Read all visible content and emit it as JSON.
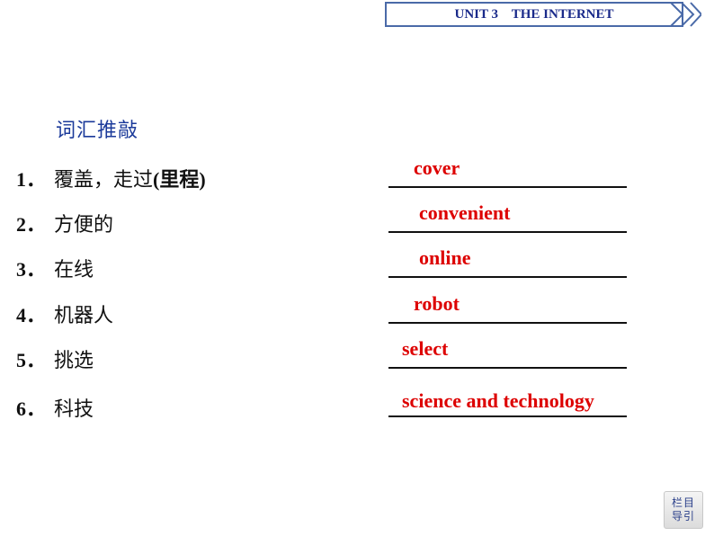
{
  "header": {
    "title": "UNIT 3    THE INTERNET"
  },
  "section": {
    "heading": "词汇推敲"
  },
  "items": [
    {
      "number": "1．",
      "prompt_cn": "覆盖，走过",
      "prompt_paren": "(里程)",
      "answer": "cover"
    },
    {
      "number": "2．",
      "prompt_cn": "方便的",
      "prompt_paren": "",
      "answer": "convenient"
    },
    {
      "number": "3．",
      "prompt_cn": "在线",
      "prompt_paren": "",
      "answer": "online"
    },
    {
      "number": "4．",
      "prompt_cn": "机器人",
      "prompt_paren": "",
      "answer": "robot"
    },
    {
      "number": "5．",
      "prompt_cn": "挑选",
      "prompt_paren": "",
      "answer": "select"
    },
    {
      "number": "6．",
      "prompt_cn": "科技",
      "prompt_paren": "",
      "answer": "science and technology"
    }
  ],
  "nav_button": {
    "line1": "栏目",
    "line2": "导引"
  },
  "colors": {
    "header_text": "#1a2a8a",
    "header_border": "#4a6aa8",
    "heading": "#1b3a9a",
    "answer": "#dd0000",
    "body_text": "#111111"
  }
}
